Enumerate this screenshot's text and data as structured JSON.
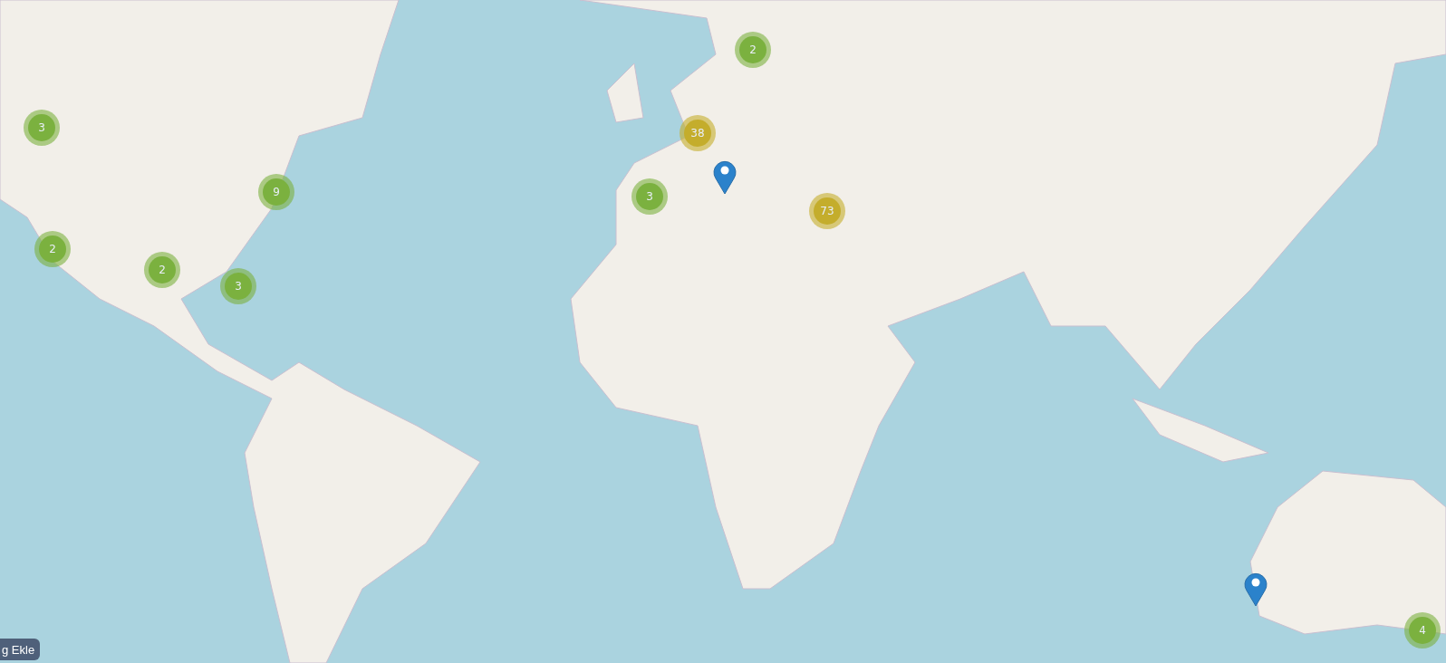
{
  "map": {
    "clusters": [
      {
        "count": "2",
        "color": "#7bb13f"
      },
      {
        "count": "3",
        "color": "#7bb13f"
      },
      {
        "count": "38",
        "color": "#c4ad2c"
      },
      {
        "count": "9",
        "color": "#7bb13f"
      },
      {
        "count": "3",
        "color": "#7bb13f"
      },
      {
        "count": "73",
        "color": "#c4ad2c"
      },
      {
        "count": "2",
        "color": "#7bb13f"
      },
      {
        "count": "2",
        "color": "#7bb13f"
      },
      {
        "count": "3",
        "color": "#7bb13f"
      },
      {
        "count": "4",
        "color": "#7bb13f"
      }
    ],
    "pins": [
      {
        "kind": "marker"
      },
      {
        "kind": "marker"
      }
    ],
    "button": {
      "label": "g Ekle"
    }
  }
}
